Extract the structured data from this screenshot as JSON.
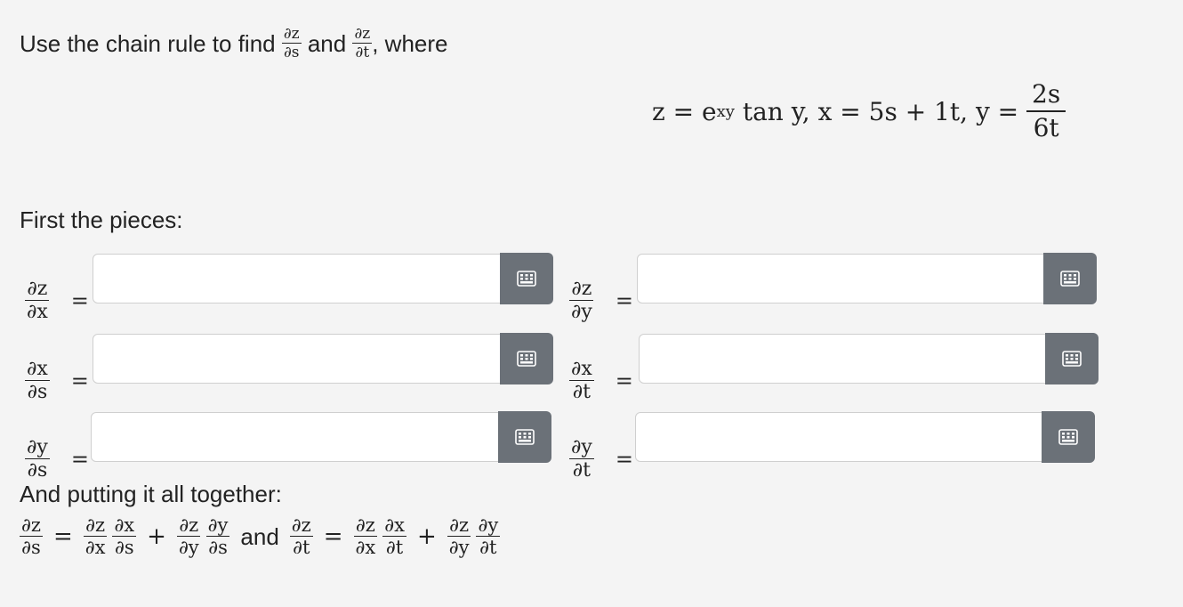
{
  "prompt": {
    "lead": "Use the chain rule to find",
    "and": "and",
    "tail": ", where"
  },
  "equation": {
    "z_def": "z = e",
    "z_exp": "xy",
    "z_rest": " tan y, x = 5s + 1t, y = ",
    "y_num": "2s",
    "y_den": "6t"
  },
  "sections": {
    "pieces": "First the pieces:",
    "together": "And putting it all together:"
  },
  "symbols": {
    "dz": "∂z",
    "dx": "∂x",
    "dy": "∂y",
    "ds": "∂s",
    "dt": "∂t",
    "eq": "=",
    "plus": "+",
    "and": "and"
  },
  "fields": [
    {
      "label_num": "∂z",
      "label_den": "∂x",
      "value": ""
    },
    {
      "label_num": "∂z",
      "label_den": "∂y",
      "value": ""
    },
    {
      "label_num": "∂x",
      "label_den": "∂s",
      "value": ""
    },
    {
      "label_num": "∂x",
      "label_den": "∂t",
      "value": ""
    },
    {
      "label_num": "∂y",
      "label_den": "∂s",
      "value": ""
    },
    {
      "label_num": "∂y",
      "label_den": "∂t",
      "value": ""
    }
  ],
  "icons": {
    "keyboard_button": "keypad-icon"
  }
}
